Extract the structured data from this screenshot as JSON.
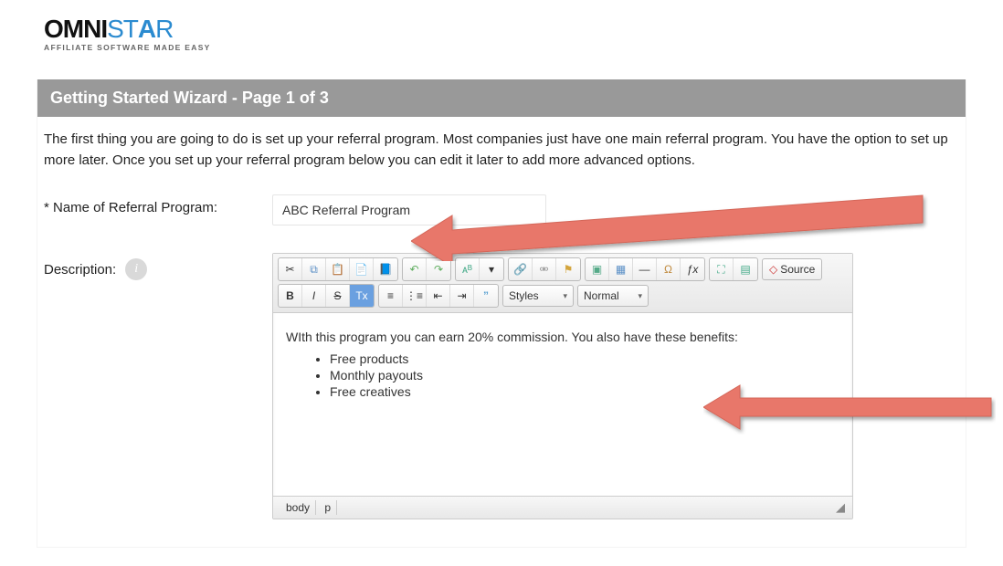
{
  "logo": {
    "brand_left": "OMNI",
    "brand_right": "ST",
    "brand_star": "A",
    "brand_end": "R",
    "tagline": "AFFILIATE SOFTWARE MADE EASY"
  },
  "header": {
    "title": "Getting Started Wizard - Page 1 of 3"
  },
  "intro": "The first thing you are going to do is set up your referral program. Most companies just have one main referral program. You have the option to set up more later. Once you set up your referral program below you can edit it later to add more advanced options.",
  "form": {
    "name_label": "* Name of Referral Program:",
    "name_value": "ABC Referral Program",
    "desc_label": "Description:",
    "info_glyph": "i"
  },
  "editor": {
    "styles_label": "Styles",
    "format_label": "Normal",
    "source_label": "Source",
    "content_line": "WIth this program you can earn 20% commission. You also have these benefits:",
    "bullets": [
      "Free products",
      "Monthly payouts",
      "Free creatives"
    ],
    "path": [
      "body",
      "p"
    ],
    "resize_glyph": "◢"
  },
  "toolbar": {
    "row1": {
      "g1": [
        "cut",
        "copy",
        "paste",
        "paste-text",
        "paste-word"
      ],
      "g2": [
        "undo",
        "redo"
      ],
      "g3": [
        "spellcheck",
        "spell-as-you-type"
      ],
      "g4": [
        "link",
        "unlink",
        "anchor"
      ],
      "g5": [
        "image",
        "table",
        "hr",
        "special-char",
        "function"
      ],
      "g6": [
        "maximize",
        "show-blocks"
      ]
    },
    "row2": {
      "g1": [
        "bold",
        "italic",
        "strike",
        "remove-format"
      ],
      "g2": [
        "ol",
        "ul",
        "outdent",
        "indent",
        "blockquote"
      ]
    }
  }
}
